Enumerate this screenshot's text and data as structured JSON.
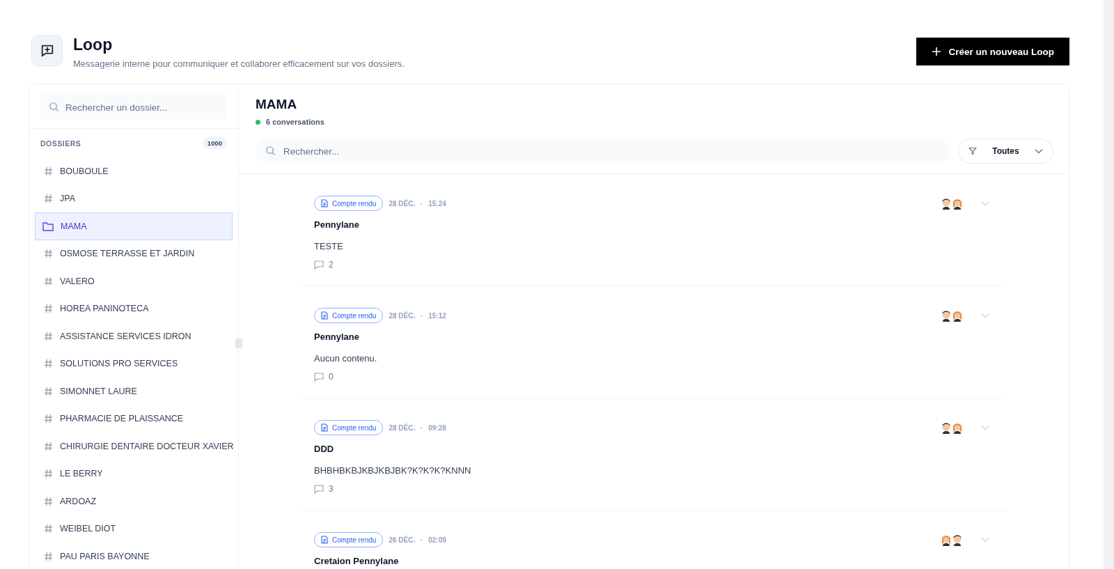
{
  "header": {
    "title": "Loop",
    "subtitle": "Messagerie interne pour communiquer et collaborer efficacement sur vos dossiers.",
    "create_button": "Créer un nouveau Loop"
  },
  "sidebar": {
    "search": {
      "placeholder": "Rechercher un dossier..."
    },
    "section_title": "DOSSIERS",
    "count": "1000",
    "items": [
      {
        "label": "BOUBOULE",
        "selected": false
      },
      {
        "label": "JPA",
        "selected": false
      },
      {
        "label": "MAMA",
        "selected": true
      },
      {
        "label": "OSMOSE TERRASSE ET JARDIN",
        "selected": false
      },
      {
        "label": "VALERO",
        "selected": false
      },
      {
        "label": "HOREA PANINOTECA",
        "selected": false
      },
      {
        "label": "ASSISTANCE SERVICES IDRON",
        "selected": false
      },
      {
        "label": "SOLUTIONS PRO SERVICES",
        "selected": false
      },
      {
        "label": "SIMONNET LAURE",
        "selected": false
      },
      {
        "label": "PHARMACIE DE PLAISSANCE",
        "selected": false
      },
      {
        "label": "CHIRURGIE DENTAIRE DOCTEUR XAVIER",
        "selected": false
      },
      {
        "label": "LE BERRY",
        "selected": false
      },
      {
        "label": "ARDOAZ",
        "selected": false
      },
      {
        "label": "WEIBEL DIOT",
        "selected": false
      },
      {
        "label": "PAU PARIS BAYONNE",
        "selected": false
      }
    ]
  },
  "conversation_panel": {
    "title": "MAMA",
    "status": "6 conversations",
    "search": {
      "placeholder": "Rechercher..."
    },
    "filter": "Toutes",
    "messages": [
      {
        "tag": "Compte rendu",
        "date": "28 DÉC.",
        "time": "15:24",
        "title": "Pennylane",
        "body": "TESTE",
        "comments": "2",
        "avatars": [
          {
            "kind": "dark-hair"
          },
          {
            "kind": "ginger-hair"
          }
        ]
      },
      {
        "tag": "Compte rendu",
        "date": "28 DÉC.",
        "time": "15:12",
        "title": "Pennylane",
        "body": "Aucun contenu.",
        "comments": "0",
        "avatars": [
          {
            "kind": "dark-hair"
          },
          {
            "kind": "ginger-hair"
          }
        ]
      },
      {
        "tag": "Compte rendu",
        "date": "28 DÉC.",
        "time": "09:28",
        "title": "DDD",
        "body": "BHBHBKBJKBJKBJBK?K?K?K?KNNN",
        "comments": "3",
        "avatars": [
          {
            "kind": "dark-hair"
          },
          {
            "kind": "ginger-hair"
          }
        ]
      },
      {
        "tag": "Compte rendu",
        "date": "26 DÉC.",
        "time": "02:09",
        "title": "Cretaion Pennylane",
        "avatars": [
          {
            "kind": "ginger-hair"
          },
          {
            "kind": "dark-hair"
          }
        ]
      }
    ]
  }
}
